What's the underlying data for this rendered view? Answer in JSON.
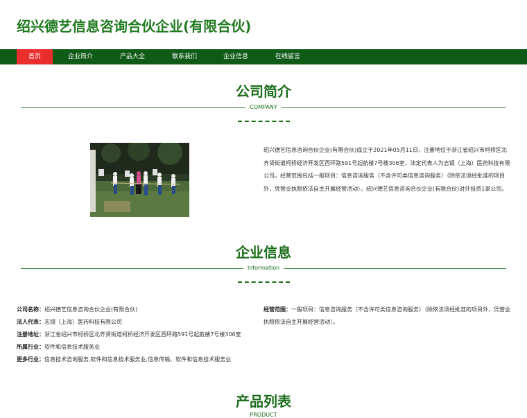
{
  "header": {
    "site_title": "绍兴德艺信息咨询合伙企业(有限合伙)"
  },
  "nav": {
    "items": [
      {
        "label": "首页",
        "active": true
      },
      {
        "label": "企业简介"
      },
      {
        "label": "产品大全"
      },
      {
        "label": "联系我们"
      },
      {
        "label": "企业信息"
      },
      {
        "label": "在线留言"
      }
    ]
  },
  "company": {
    "title": "公司简介",
    "subtitle": "COMPANY",
    "description": "绍兴德艺信息咨询合伙企业(有限合伙)成立于2021年05月11日，注册地位于浙江省绍兴市柯桥区北齐贤街道柯桥经济开发区西环路591号起航楼7号楼306室，法定代表人为志镜（上海）医药科技有限公司。经营范围包括一般项目：信息咨询服务（不含许可类信息咨询服务）（除依法须经批准的项目外，凭营业执照依法自主开展经营活动）。绍兴德艺信息咨询合伙企业(有限合伙)对外投资1家公司。"
  },
  "info": {
    "title": "企业信息",
    "subtitle": "Information",
    "fields": [
      {
        "label": "公司名称：",
        "value": "绍兴德艺信息咨询合伙企业(有限合伙)"
      },
      {
        "label": "法人代表：",
        "value": "志镜（上海）医药科技有限公司"
      },
      {
        "label": "注册地址：",
        "value": "浙江省绍兴市柯桥区北齐贤街道柯桥经济开发区西环路591号起航楼7号楼306室"
      },
      {
        "label": "所属行业：",
        "value": "软件和信息技术服务业"
      },
      {
        "label": "更多行业：",
        "value": "信息技术咨询服务,软件和信息技术服务业,信息传输、软件和信息技术服务业"
      }
    ],
    "scope": {
      "label": "经营范围：",
      "value": "一般项目：信息咨询服务（不含许可类信息咨询服务）（除依法须经批准的项目外，凭营业执照依法自主开展经营活动）。"
    }
  },
  "products": {
    "title": "产品列表",
    "subtitle": "PRODUCT"
  },
  "colors": {
    "nav_bg": "#0e5a16",
    "nav_active": "#ea2e2e",
    "accent": "#1a6d1a"
  }
}
